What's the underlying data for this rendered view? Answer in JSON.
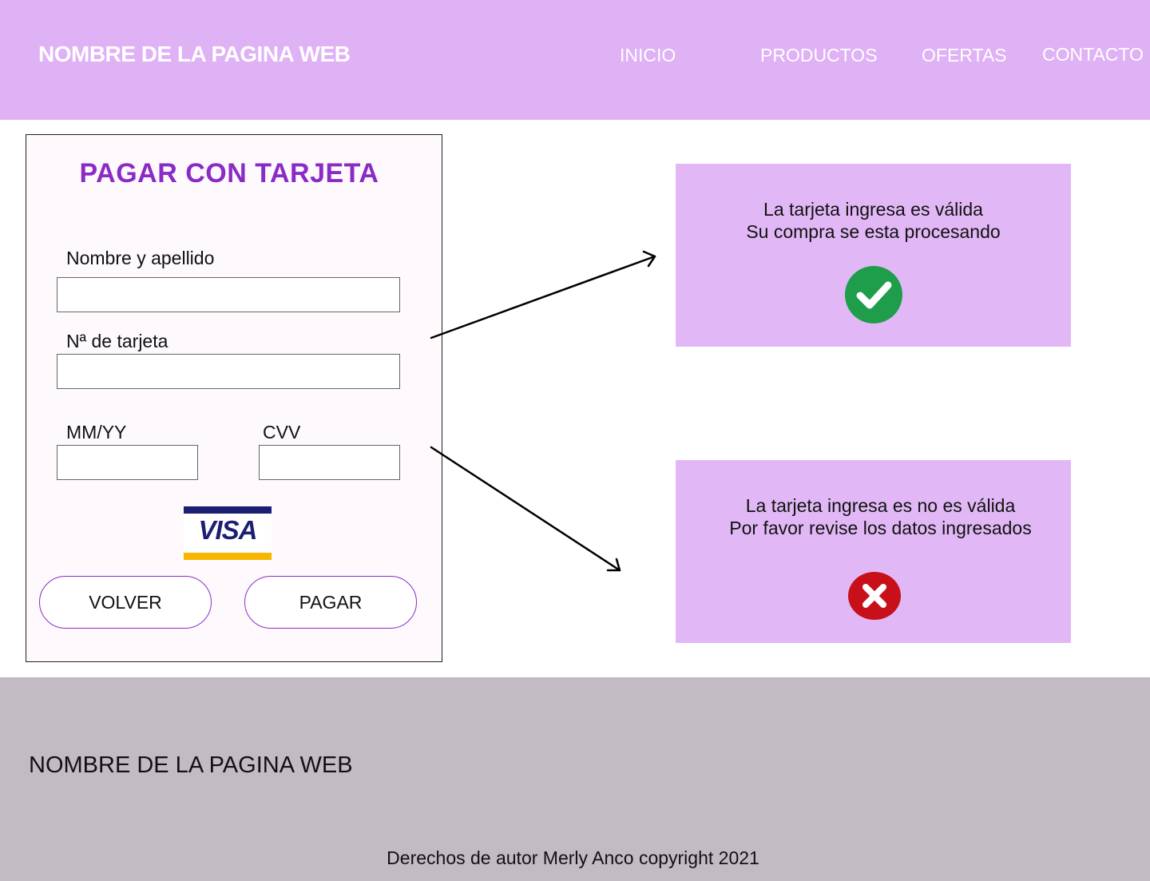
{
  "header": {
    "site_title": "NOMBRE DE LA PAGINA WEB",
    "nav": [
      "INICIO",
      "PRODUCTOS",
      "OFERTAS",
      "CONTACTO"
    ],
    "background": "#dfb1f5"
  },
  "payment_form": {
    "title": "PAGAR CON TARJETA",
    "name_label": "Nombre y apellido",
    "name_value": "",
    "card_number_label": "Nª de tarjeta",
    "card_number_value": "",
    "expiry_label": "MM/YY",
    "expiry_value": "",
    "cvv_label": "CVV",
    "cvv_value": "",
    "card_brand": "VISA",
    "back_button": "VOLVER",
    "pay_button": "PAGAR",
    "title_color": "#8b2bc5"
  },
  "success_message": {
    "line1": "La tarjeta ingresa es válida",
    "line2": "Su compra se esta procesando",
    "icon": "check-circle-icon",
    "color": "#1e9d4b"
  },
  "error_message": {
    "line1": "La tarjeta ingresa es no es válida",
    "line2": "Por favor revise los datos ingresados",
    "icon": "x-circle-icon",
    "color": "#c8101a"
  },
  "footer": {
    "site_title": "NOMBRE DE LA PAGINA WEB",
    "copyright": "Derechos de autor Merly Anco copyright 2021",
    "background": "#c3bbc4"
  }
}
